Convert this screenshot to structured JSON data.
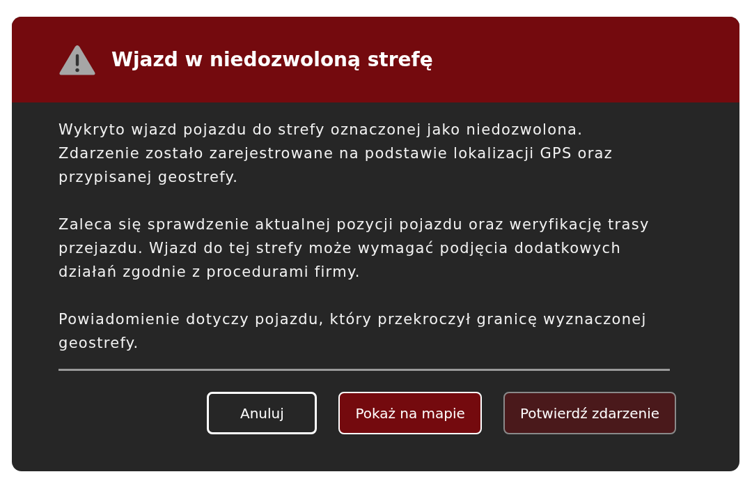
{
  "dialog": {
    "title": "Wjazd w niedozwoloną strefę",
    "paragraphs": [
      "Wykryto wjazd pojazdu do strefy oznaczonej jako niedozwolona. Zdarzenie zostało zarejestrowane na podstawie lokalizacji GPS oraz przypisanej geostrefy.",
      "Zaleca się sprawdzenie aktualnej pozycji pojazdu oraz weryfikację trasy przejazdu. Wjazd do tej strefy może wymagać podjęcia dodatkowych działań zgodnie z procedurami firmy.",
      "Powiadomienie dotyczy pojazdu, który przekroczył granicę wyznaczonej geostrefy."
    ],
    "buttons": [
      {
        "label": "Anuluj",
        "kind": "outline"
      },
      {
        "label": "Pokaż na mapie",
        "kind": "primary"
      },
      {
        "label": "Potwierdź zdarzenie",
        "kind": "secondary"
      }
    ]
  }
}
